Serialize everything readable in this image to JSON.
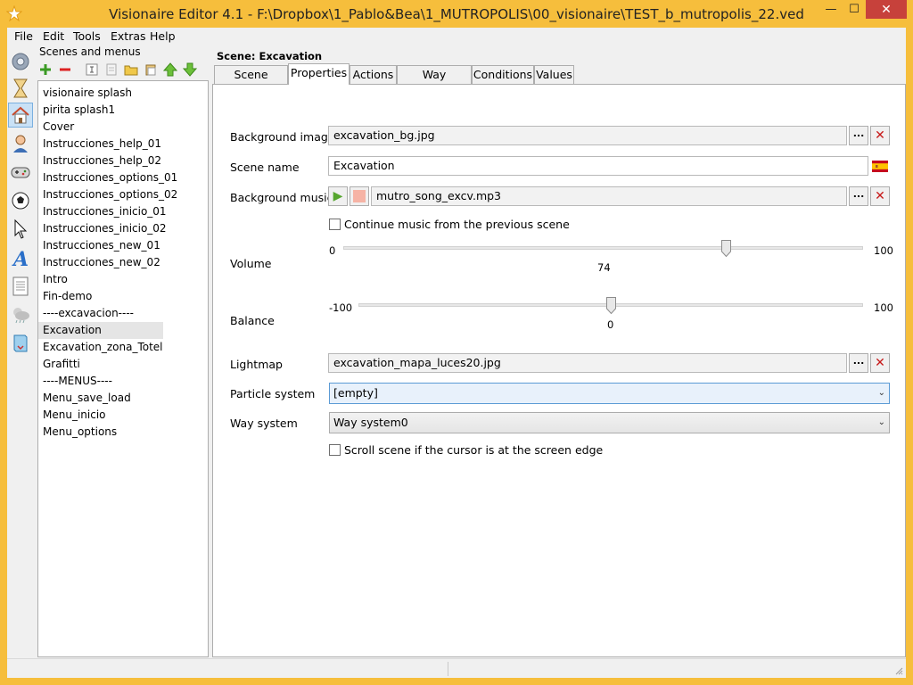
{
  "window": {
    "title": "Visionaire Editor 4.1 - F:\\Dropbox\\1_Pablo&Bea\\1_MUTROPOLIS\\00_visionaire\\TEST_b_mutropolis_22.ved",
    "minimize_glyph": "—",
    "maximize_glyph": "☐",
    "close_glyph": "✕"
  },
  "menu": [
    "File",
    "Edit",
    "Tools",
    "Extras",
    "Help"
  ],
  "sidebar_icons": [
    "settings-icon",
    "hourglass-icon",
    "home-icon",
    "character-icon",
    "gamepad-icon",
    "ball-icon",
    "cursor-icon",
    "font-icon",
    "text-document-icon",
    "weather-icon",
    "script-icon"
  ],
  "left_panel": {
    "title": "Scenes and menus",
    "toolbar": [
      "add-icon",
      "remove-icon",
      "rename-icon",
      "copy-icon",
      "folder-icon",
      "paste-icon",
      "move-up-icon",
      "move-down-icon"
    ],
    "items": [
      "visionaire splash",
      "pirita splash1",
      "Cover",
      "Instrucciones_help_01",
      "Instrucciones_help_02",
      "Instrucciones_options_01",
      "Instrucciones_options_02",
      "Instrucciones_inicio_01",
      "Instrucciones_inicio_02",
      "Instrucciones_new_01",
      "Instrucciones_new_02",
      "Intro",
      "Fin-demo",
      "----excavacion----",
      "Excavation",
      "Excavation_zona_Totel",
      "Grafitti",
      "----MENUS----",
      "Menu_save_load",
      "Menu_inicio",
      "Menu_options"
    ],
    "selected": "Excavation"
  },
  "scene": {
    "header": "Scene: Excavation",
    "tabs": [
      "Scene objects",
      "Properties",
      "Actions",
      "Way systems",
      "Conditions",
      "Values"
    ],
    "active_tab": "Properties"
  },
  "properties": {
    "background_image_label": "Background image",
    "background_image_value": "excavation_bg.jpg",
    "scene_name_label": "Scene name",
    "scene_name_value": "Excavation",
    "background_music_label": "Background music",
    "background_music_value": "mutro_song_excv.mp3",
    "continue_music_label": "Continue music from the previous scene",
    "continue_music_checked": false,
    "volume_label": "Volume",
    "volume_min": "0",
    "volume_max": "100",
    "volume_value": "74",
    "balance_label": "Balance",
    "balance_min": "-100",
    "balance_max": "100",
    "balance_value": "0",
    "lightmap_label": "Lightmap",
    "lightmap_value": "excavation_mapa_luces20.jpg",
    "particle_system_label": "Particle system",
    "particle_system_value": "[empty]",
    "way_system_label": "Way system",
    "way_system_value": "Way system0",
    "scroll_scene_label": "Scroll scene if the cursor is at the screen edge",
    "scroll_scene_checked": false,
    "browse_label": "...",
    "clear_glyph": "✕",
    "play_glyph": "▶",
    "dropdown_glyph": "⌄"
  },
  "colors": {
    "titlebar": "#f6be3c",
    "close_button": "#c7413b",
    "clear_button": "#c71919",
    "play_button": "#56a62f",
    "stop_button": "#f6b3a5"
  }
}
